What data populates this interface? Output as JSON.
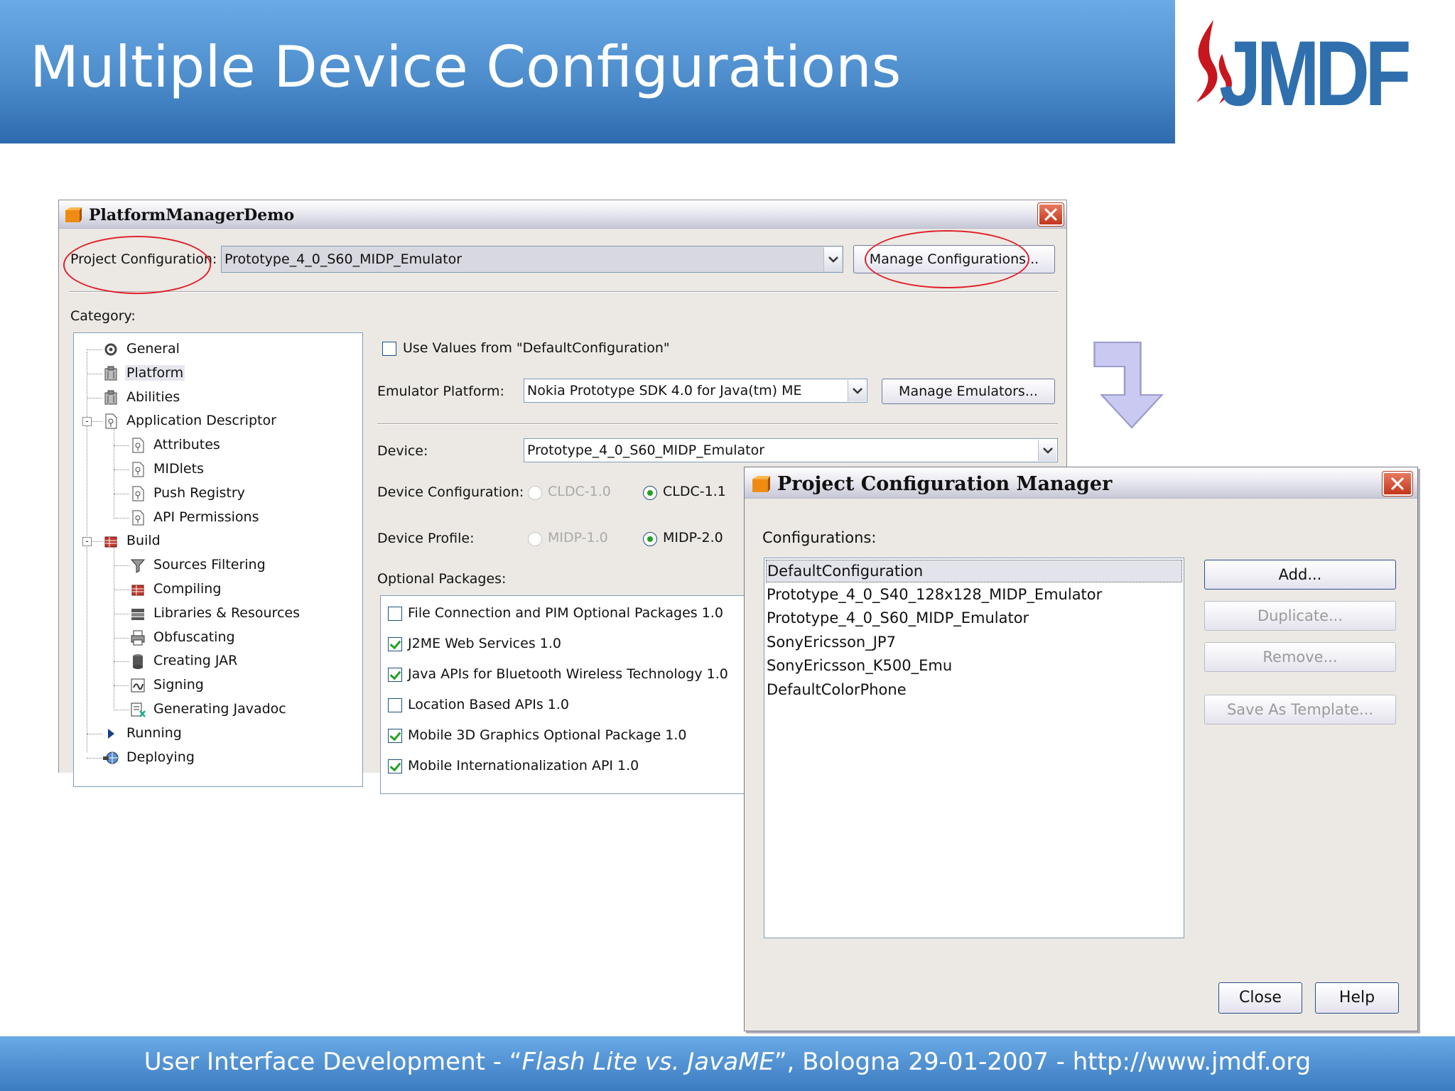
{
  "slide": {
    "title": "Multiple Device Configurations",
    "logo_text": "JMDF",
    "footer_prefix": "User Interface Development - “",
    "footer_italic": "Flash Lite vs. JavaME",
    "footer_suffix": "”, Bologna 29-01-2007 - http://www.jmdf.org"
  },
  "colors": {
    "header_blue": "#4d8dcc",
    "logo_blue": "#2f6fae",
    "annotation_red": "#e0202a"
  },
  "props_window": {
    "title": "PlatformManagerDemo",
    "project_config_label": "Project Configuration:",
    "project_config_value": "Prototype_4_0_S60_MIDP_Emulator",
    "manage_configs_button": "Manage Configurations...",
    "category_label": "Category:",
    "tree": [
      {
        "label": "General",
        "icon": "gears-icon"
      },
      {
        "label": "Platform",
        "icon": "platform-icon",
        "selected": true
      },
      {
        "label": "Abilities",
        "icon": "platform-icon"
      },
      {
        "label": "Application Descriptor",
        "icon": "document-icon"
      },
      {
        "label": "Attributes",
        "icon": "document-icon"
      },
      {
        "label": "MIDlets",
        "icon": "document-icon"
      },
      {
        "label": "Push Registry",
        "icon": "document-icon"
      },
      {
        "label": "API Permissions",
        "icon": "document-icon"
      },
      {
        "label": "Build",
        "icon": "build-icon"
      },
      {
        "label": "Sources Filtering",
        "icon": "filter-icon"
      },
      {
        "label": "Compiling",
        "icon": "build-icon"
      },
      {
        "label": "Libraries & Resources",
        "icon": "books-icon"
      },
      {
        "label": "Obfuscating",
        "icon": "printer-icon"
      },
      {
        "label": "Creating JAR",
        "icon": "jar-icon"
      },
      {
        "label": "Signing",
        "icon": "signing-icon"
      },
      {
        "label": "Generating Javadoc",
        "icon": "javadoc-icon"
      },
      {
        "label": "Running",
        "icon": "play-icon"
      },
      {
        "label": "Deploying",
        "icon": "globe-icon"
      }
    ],
    "use_default_checkbox": "Use Values from \"DefaultConfiguration\"",
    "emulator_platform_label": "Emulator Platform:",
    "emulator_platform_value": "Nokia Prototype SDK 4.0 for Java(tm) ME",
    "manage_emulators_button": "Manage Emulators...",
    "device_label": "Device:",
    "device_value": "Prototype_4_0_S60_MIDP_Emulator",
    "device_config_label": "Device Configuration:",
    "cldc10": "CLDC-1.0",
    "cldc11": "CLDC-1.1",
    "device_profile_label": "Device Profile:",
    "midp10": "MIDP-1.0",
    "midp20": "MIDP-2.0",
    "optional_packages_label": "Optional Packages:",
    "packages": [
      {
        "label": "File Connection and PIM Optional Packages 1.0",
        "checked": false
      },
      {
        "label": "J2ME Web Services 1.0",
        "checked": true
      },
      {
        "label": "Java APIs for Bluetooth Wireless Technology 1.0",
        "checked": true
      },
      {
        "label": "Location Based APIs 1.0",
        "checked": false
      },
      {
        "label": "Mobile 3D Graphics Optional Package 1.0",
        "checked": true
      },
      {
        "label": "Mobile Internationalization API 1.0",
        "checked": true
      }
    ]
  },
  "manager_window": {
    "title": "Project Configuration Manager",
    "configurations_label": "Configurations:",
    "configurations": [
      "DefaultConfiguration",
      "Prototype_4_0_S40_128x128_MIDP_Emulator",
      "Prototype_4_0_S60_MIDP_Emulator",
      "SonyEricsson_JP7",
      "SonyEricsson_K500_Emu",
      "DefaultColorPhone"
    ],
    "add_button": "Add...",
    "duplicate_button": "Duplicate...",
    "remove_button": "Remove...",
    "save_template_button": "Save As Template...",
    "close_button": "Close",
    "help_button": "Help"
  }
}
